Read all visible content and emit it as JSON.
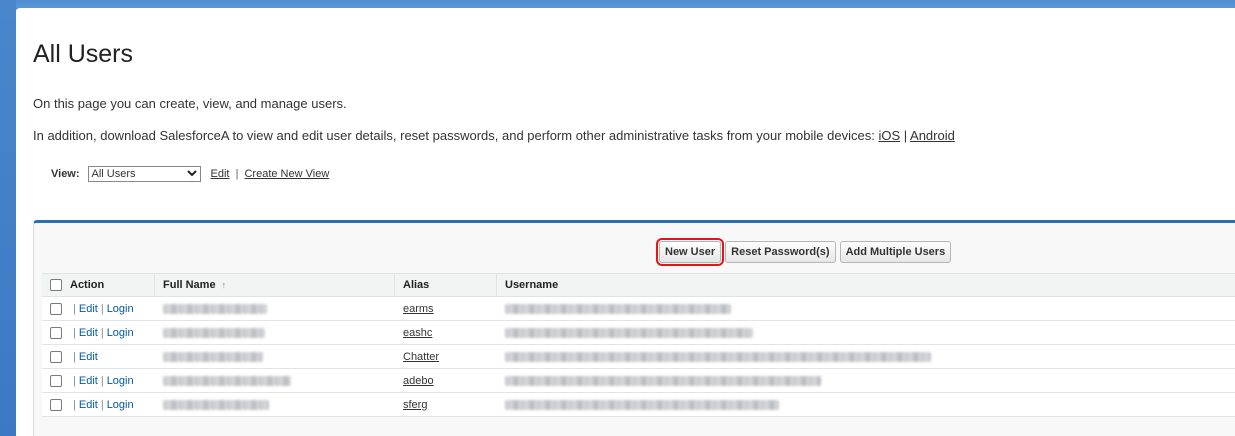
{
  "page": {
    "title": "All Users",
    "intro": "On this page you can create, view, and manage users.",
    "addition_text": "In addition, download SalesforceA to view and edit user details, reset passwords, and perform other administrative tasks from your mobile devices:",
    "ios_link": "iOS",
    "android_link": "Android",
    "link_sep": "|"
  },
  "view_bar": {
    "label": "View:",
    "selected": "All Users",
    "edit_link": "Edit",
    "create_link": "Create New View",
    "sep": "|"
  },
  "buttons": {
    "new_user": "New User",
    "reset_password": "Reset Password(s)",
    "add_multiple": "Add Multiple Users"
  },
  "table": {
    "headers": {
      "action": "Action",
      "full_name": "Full Name",
      "sort_indicator": "↑",
      "alias": "Alias",
      "username": "Username"
    },
    "rows": [
      {
        "edit": "Edit",
        "login": "Login",
        "alias": "earms"
      },
      {
        "edit": "Edit",
        "login": "Login",
        "alias": "eashc"
      },
      {
        "edit": "Edit",
        "login": "",
        "alias": "Chatter"
      },
      {
        "edit": "Edit",
        "login": "Login",
        "alias": "adebo"
      },
      {
        "edit": "Edit",
        "login": "Login",
        "alias": "sferg"
      }
    ]
  },
  "colors": {
    "header_band": "#4f8dd1",
    "panel_accent": "#2a6fba",
    "link_blue": "#015ba7",
    "highlight_red": "#e4141b"
  }
}
